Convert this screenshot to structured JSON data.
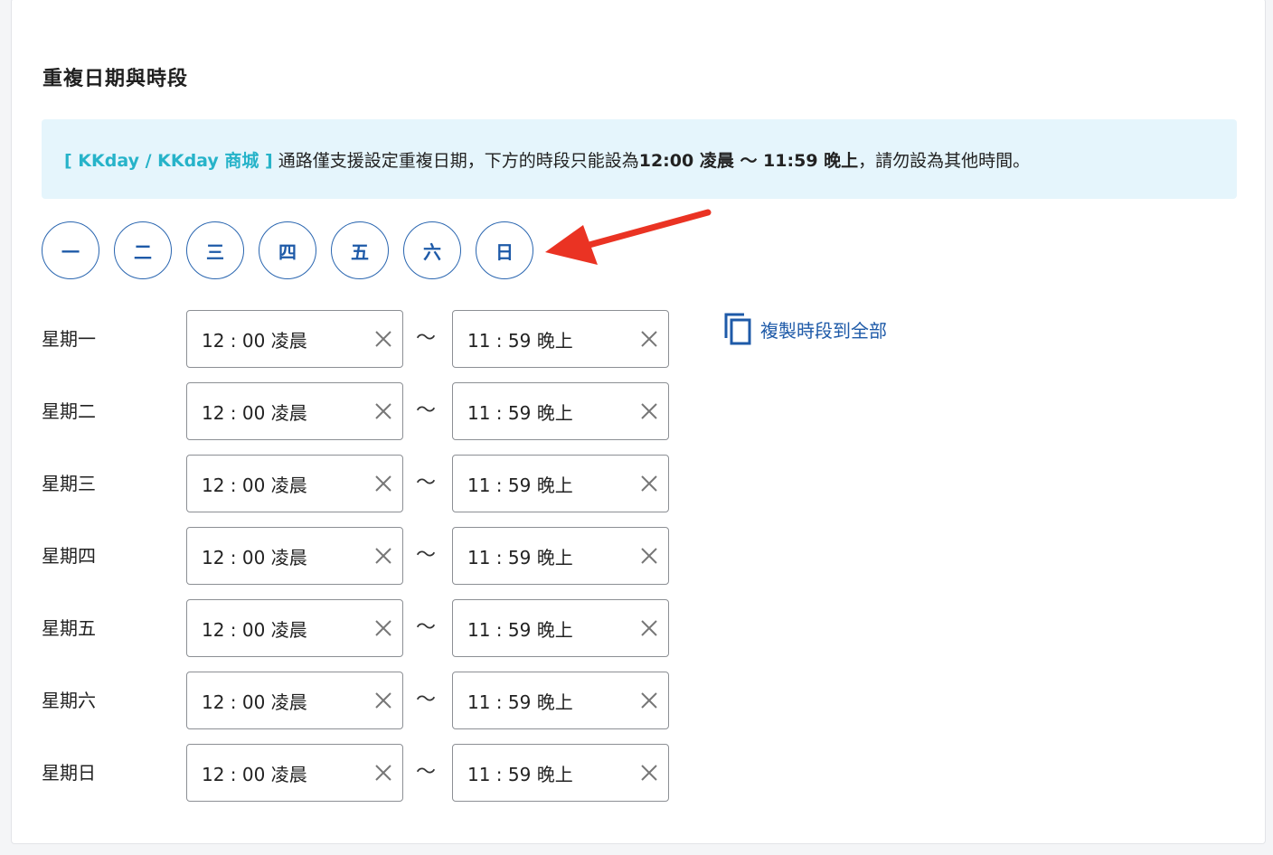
{
  "section": {
    "title": "重複日期與時段"
  },
  "notice": {
    "tag": "[ KKday / KKday 商城 ]",
    "text_before": "通路僅支援設定重複日期，下方的時段只能設為 ",
    "bold": "12:00 凌晨 〜 11:59 晚上",
    "text_after": "，請勿設為其他時間。"
  },
  "day_buttons": [
    "一",
    "二",
    "三",
    "四",
    "五",
    "六",
    "日"
  ],
  "copy_link": {
    "label": "複製時段到全部",
    "icon": "copy-icon"
  },
  "separator": "〜",
  "rows": [
    {
      "label": "星期一",
      "start": "12 : 00 凌晨",
      "end": "11 : 59 晚上"
    },
    {
      "label": "星期二",
      "start": "12 : 00 凌晨",
      "end": "11 : 59 晚上"
    },
    {
      "label": "星期三",
      "start": "12 : 00 凌晨",
      "end": "11 : 59 晚上"
    },
    {
      "label": "星期四",
      "start": "12 : 00 凌晨",
      "end": "11 : 59 晚上"
    },
    {
      "label": "星期五",
      "start": "12 : 00 凌晨",
      "end": "11 : 59 晚上"
    },
    {
      "label": "星期六",
      "start": "12 : 00 凌晨",
      "end": "11 : 59 晚上"
    },
    {
      "label": "星期日",
      "start": "12 : 00 凌晨",
      "end": "11 : 59 晚上"
    }
  ],
  "colors": {
    "accent": "#1e5aa8",
    "tag": "#26b3c9",
    "notice_bg": "#e5f5fc",
    "annotation_arrow": "#ea3323"
  }
}
